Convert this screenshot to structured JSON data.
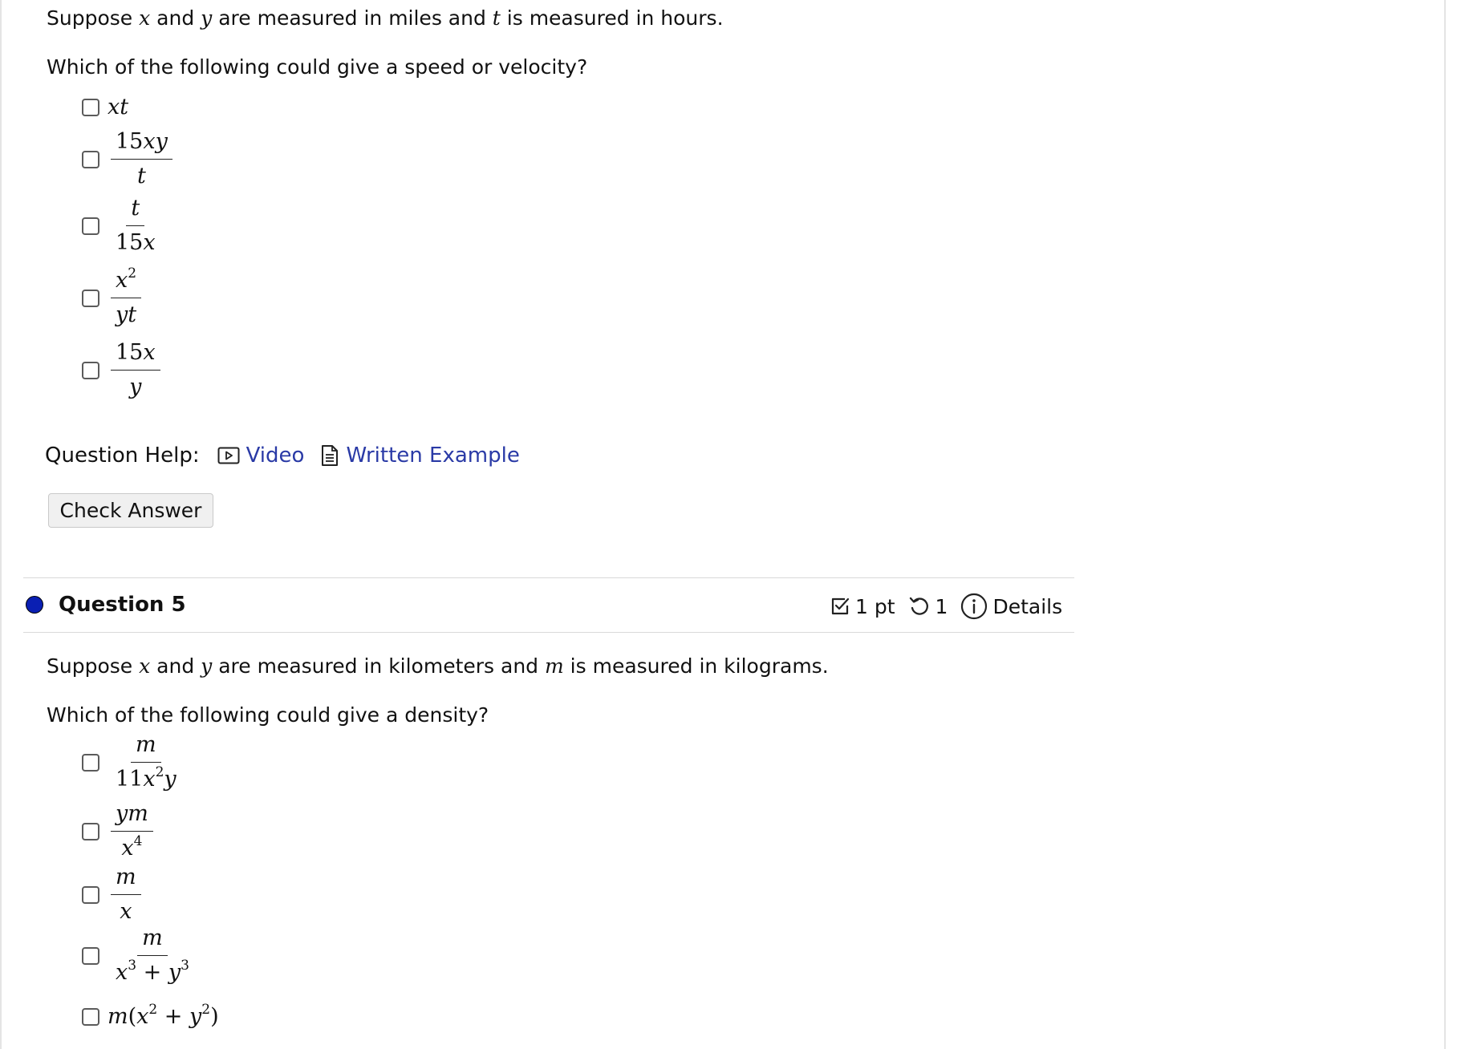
{
  "question4": {
    "prompt": {
      "p1": "Suppose ",
      "v1": "x",
      "p2": " and ",
      "v2": "y",
      "p3": " are measured in miles and ",
      "v3": "t",
      "p4": " is measured in hours."
    },
    "question": "Which of the following could give a speed or velocity?",
    "choices": [
      {
        "type": "inline",
        "expr": "xt"
      },
      {
        "type": "frac",
        "num": "15xy",
        "den": "t"
      },
      {
        "type": "frac",
        "num": "t",
        "den": "15x"
      },
      {
        "type": "frac",
        "num": "x2",
        "den": "yt"
      },
      {
        "type": "frac",
        "num": "15x",
        "den": "y"
      }
    ],
    "help_label": "Question Help:",
    "help_video": "Video",
    "help_written": "Written Example",
    "check_answer": "Check Answer"
  },
  "question5": {
    "title": "Question 5",
    "points": "1 pt",
    "attempts": "1",
    "details": "Details",
    "prompt": {
      "p1": "Suppose ",
      "v1": "x",
      "p2": " and ",
      "v2": "y",
      "p3": " are measured in kilometers and ",
      "v3": "m",
      "p4": " is measured in kilograms."
    },
    "question": "Which of the following could give a density?",
    "choices": [
      {
        "type": "frac",
        "num": "m",
        "den": "11x2y"
      },
      {
        "type": "frac",
        "num": "ym",
        "den": "x4"
      },
      {
        "type": "frac",
        "num": "m",
        "den": "x"
      },
      {
        "type": "frac",
        "num": "m",
        "den": "x3 + y3"
      },
      {
        "type": "inline",
        "expr": "m(x2 + y2)"
      }
    ]
  },
  "colors": {
    "link": "#2a3aa6",
    "status_dot": "#0a1fb3",
    "button_bg": "#f0f0f0"
  },
  "icons": [
    "video-icon",
    "document-icon",
    "checkbox-icon",
    "retry-icon",
    "info-icon"
  ]
}
